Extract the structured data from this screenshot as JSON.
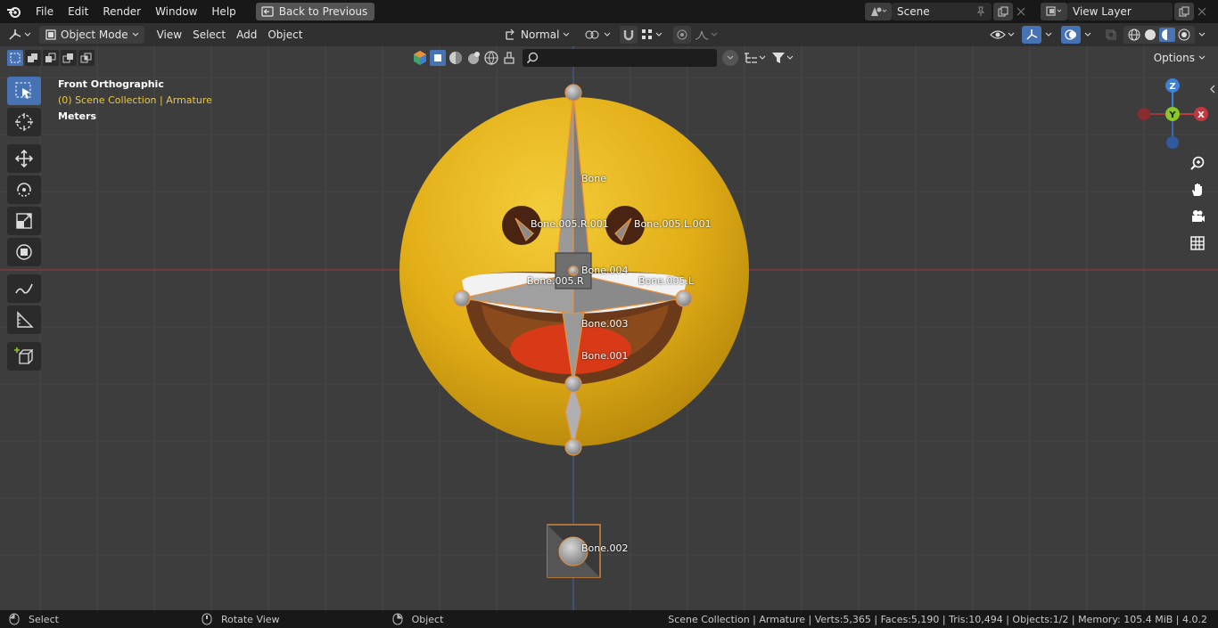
{
  "topbar": {
    "menus": [
      "File",
      "Edit",
      "Render",
      "Window",
      "Help"
    ],
    "back_button": "Back to Previous",
    "scene": "Scene",
    "view_layer": "View Layer"
  },
  "header": {
    "mode": "Object Mode",
    "menus": [
      "View",
      "Select",
      "Add",
      "Object"
    ],
    "transform_orientation": "Normal"
  },
  "viewport": {
    "view_name": "Front Orthographic",
    "collection_info": "(0) Scene Collection | Armature",
    "units": "Meters",
    "options_label": "Options",
    "search_placeholder": ""
  },
  "bones": {
    "bone": "Bone",
    "bone_005_r_001": "Bone.005.R.001",
    "bone_005_l_001": "Bone.005.L.001",
    "bone_004": "Bone.004",
    "bone_005_r": "Bone.005.R",
    "bone_005_l": "Bone.005.L",
    "bone_003": "Bone.003",
    "bone_001": "Bone.001",
    "bone_002": "Bone.002"
  },
  "gizmo": {
    "z": "Z",
    "y": "Y",
    "x": "X"
  },
  "statusbar": {
    "select": "Select",
    "rotate_view": "Rotate View",
    "object": "Object",
    "stats": "Scene Collection | Armature | Verts:5,365 | Faces:5,190 | Tris:10,494 | Objects:1/2 | Memory: 105.4 MiB | 4.0.2"
  },
  "colors": {
    "accent": "#4772b3",
    "selection_orange": "#e8913a",
    "emoji_yellow": "#e3b21a",
    "axis_red": "#c3383e",
    "axis_green": "#8ac728",
    "axis_blue": "#3f7fd6"
  }
}
